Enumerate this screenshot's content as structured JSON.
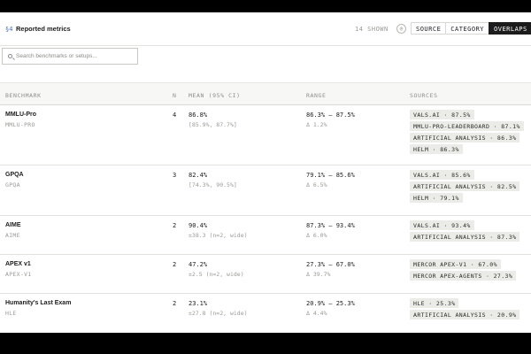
{
  "header": {
    "section": "§4",
    "title": "Reported metrics",
    "shown": "14 SHOWN",
    "eye_glyph": "◎",
    "tabs": [
      {
        "label": "SOURCE",
        "active": false
      },
      {
        "label": "CATEGORY",
        "active": false
      },
      {
        "label": "OVERLAPS",
        "active": true
      }
    ]
  },
  "search": {
    "placeholder": "Search benchmarks or setups..."
  },
  "table": {
    "columns": [
      "BENCHMARK",
      "N",
      "MEAN (95% CI)",
      "RANGE",
      "SOURCES"
    ],
    "rows": [
      {
        "name": "MMLU-Pro",
        "sub": "MMLU-PRO",
        "n": "4",
        "mean": "86.8%",
        "ci": "[85.9%, 87.7%]",
        "range": "86.3% – 87.5%",
        "delta": "Δ 1.2%",
        "sources": [
          "VALS.AI · 87.5%",
          "MMLU-PRO-LEADERBOARD · 87.1%",
          "ARTIFICIAL ANALYSIS · 86.3%",
          "HELM · 86.3%"
        ]
      },
      {
        "name": "GPQA",
        "sub": "GPQA",
        "n": "3",
        "mean": "82.4%",
        "ci": "[74.3%, 90.5%]",
        "range": "79.1% – 85.6%",
        "delta": "Δ 6.5%",
        "sources": [
          "VALS.AI · 85.6%",
          "ARTIFICIAL ANALYSIS · 82.5%",
          "HELM · 79.1%"
        ]
      },
      {
        "name": "AIME",
        "sub": "AIME",
        "n": "2",
        "mean": "90.4%",
        "ci": "±38.3 (n=2, wide)",
        "range": "87.3% – 93.4%",
        "delta": "Δ 6.0%",
        "sources": [
          "VALS.AI · 93.4%",
          "ARTIFICIAL ANALYSIS · 87.3%"
        ]
      },
      {
        "name": "APEX v1",
        "sub": "APEX-V1",
        "n": "2",
        "mean": "47.2%",
        "ci": "±2.5 (n=2, wide)",
        "range": "27.3% – 67.0%",
        "delta": "Δ 39.7%",
        "sources": [
          "MERCOR APEX-V1 · 67.0%",
          "MERCOR APEX-AGENTS · 27.3%"
        ]
      },
      {
        "name": "Humanity's Last Exam",
        "sub": "HLE",
        "n": "2",
        "mean": "23.1%",
        "ci": "±27.8 (n=2, wide)",
        "range": "20.9% – 25.3%",
        "delta": "Δ 4.4%",
        "sources": [
          "HLE · 25.3%",
          "ARTIFICIAL ANALYSIS · 20.9%"
        ]
      }
    ]
  },
  "colors": {
    "accent_section": "#4a6fb3",
    "active_tab_bg": "#1c1c1c",
    "chip_bg": "#ebebe7"
  }
}
